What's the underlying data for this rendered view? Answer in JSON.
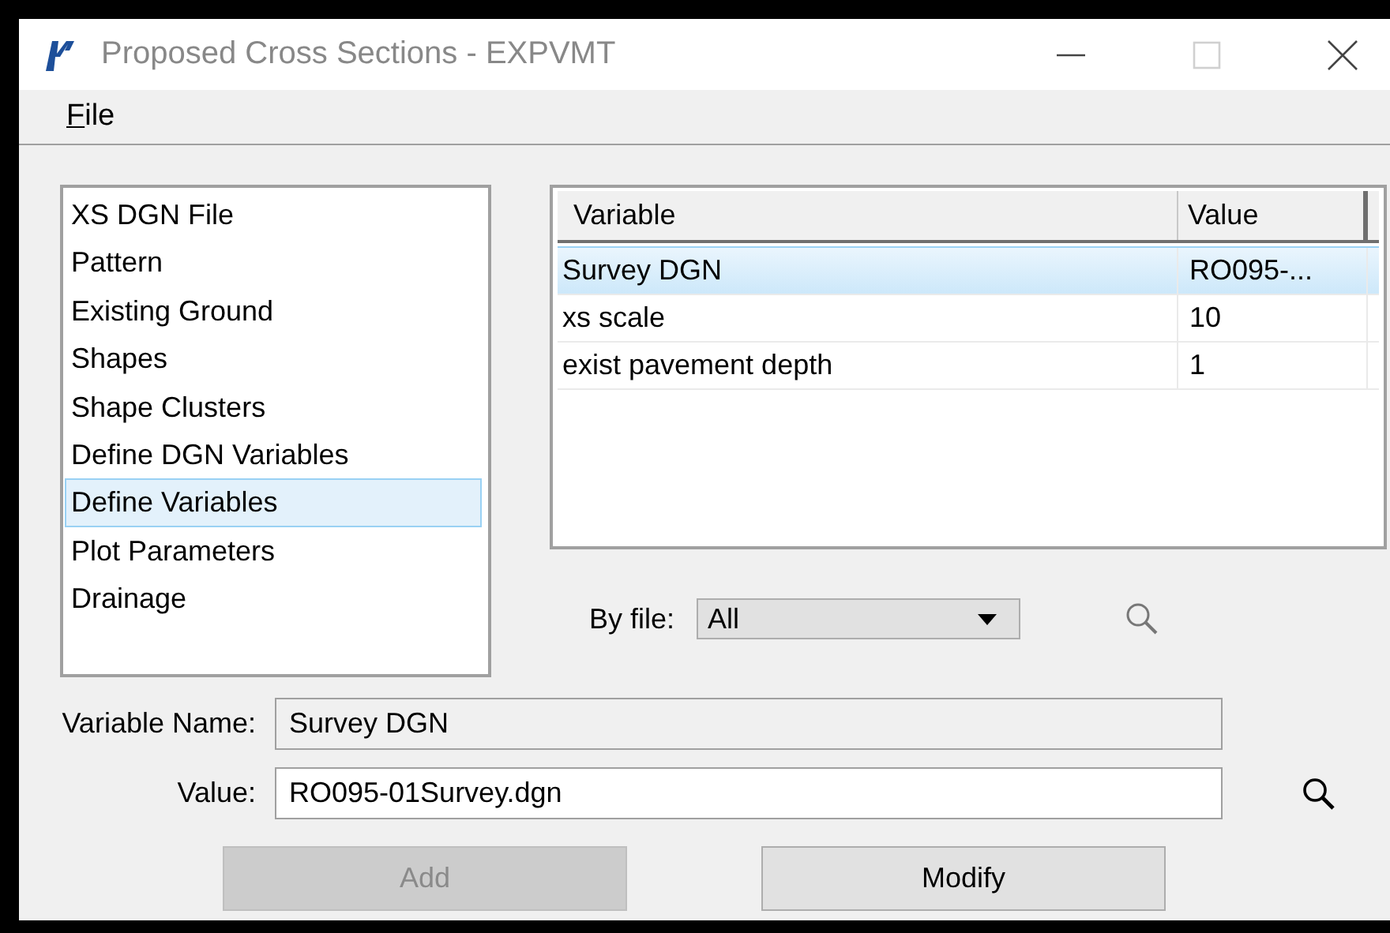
{
  "window": {
    "title": "Proposed Cross Sections - EXPVMT"
  },
  "menu": [
    {
      "label": "File"
    }
  ],
  "sidebar": {
    "items": [
      {
        "label": "XS DGN File",
        "selected": false
      },
      {
        "label": "Pattern",
        "selected": false
      },
      {
        "label": "Existing Ground",
        "selected": false
      },
      {
        "label": "Shapes",
        "selected": false
      },
      {
        "label": "Shape Clusters",
        "selected": false
      },
      {
        "label": "Define DGN Variables",
        "selected": false
      },
      {
        "label": "Define Variables",
        "selected": true
      },
      {
        "label": "Plot Parameters",
        "selected": false
      },
      {
        "label": "Drainage",
        "selected": false
      }
    ]
  },
  "table": {
    "columns": [
      "Variable",
      "Value"
    ],
    "rows": [
      {
        "cells": [
          "Survey DGN",
          "RO095-..."
        ],
        "selected": true
      },
      {
        "cells": [
          "xs scale",
          "10"
        ],
        "selected": false
      },
      {
        "cells": [
          "exist pavement depth",
          "1"
        ],
        "selected": false
      }
    ]
  },
  "filter": {
    "label": "By file:",
    "value": "All"
  },
  "fields": [
    {
      "label": "Variable Name:",
      "value": "Survey DGN",
      "disabled": true,
      "browse": false
    },
    {
      "label": "Value:",
      "value": "RO095-01Survey.dgn",
      "disabled": false,
      "browse": true
    }
  ],
  "buttons": [
    {
      "label": "Add",
      "disabled": true
    },
    {
      "label": "Modify",
      "disabled": false
    }
  ]
}
